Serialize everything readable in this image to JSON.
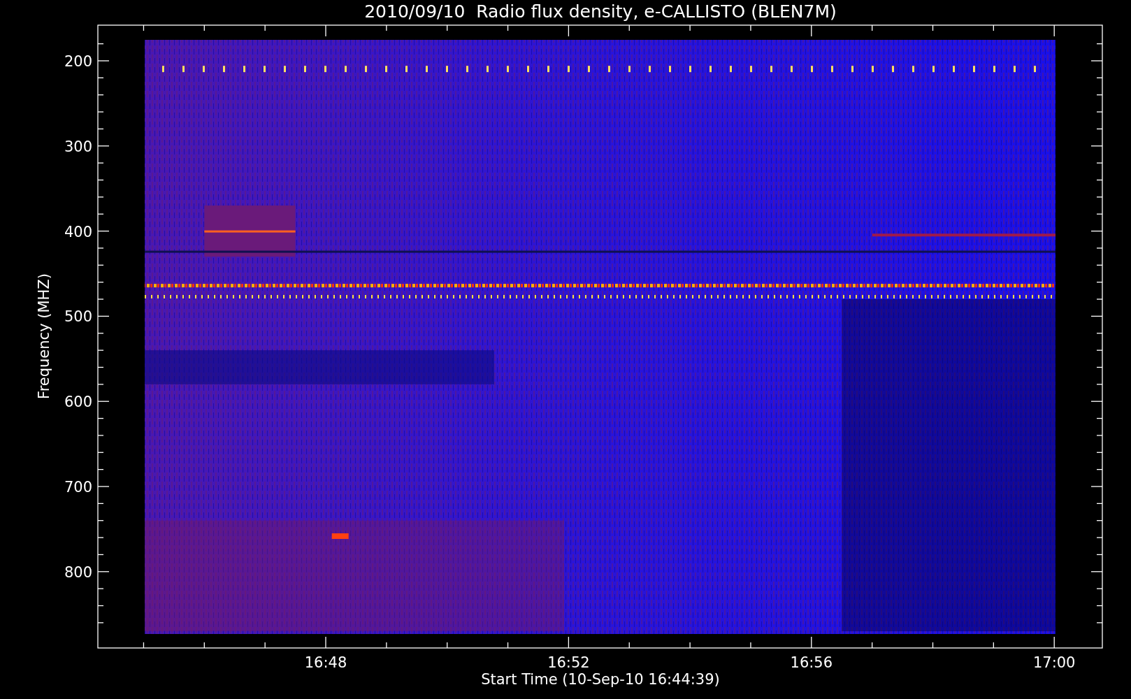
{
  "title": "2010/09/10  Radio flux density, e-CALLISTO (BLEN7M)",
  "y_axis": {
    "label": "Frequency (MHZ)",
    "ticks": [
      "200",
      "300",
      "400",
      "500",
      "600",
      "700",
      "800"
    ]
  },
  "x_axis": {
    "label": "Start Time (10-Sep-10 16:44:39)",
    "ticks": [
      "16:48",
      "16:52",
      "16:56",
      "17:00"
    ]
  }
}
